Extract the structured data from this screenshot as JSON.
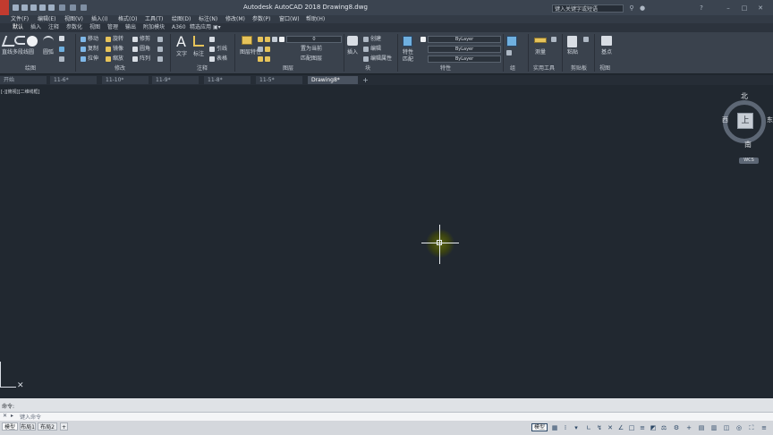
{
  "window": {
    "title": "Autodesk AutoCAD 2018    Drawing8.dwg",
    "search_placeholder": "键入关键字或短语"
  },
  "menu_items": [
    "文件(F)",
    "编辑(E)",
    "视图(V)",
    "插入(I)",
    "格式(O)",
    "工具(T)",
    "绘图(D)",
    "标注(N)",
    "修改(M)",
    "参数(P)",
    "窗口(W)",
    "帮助(H)"
  ],
  "ribbon_tabs": [
    "默认",
    "插入",
    "注释",
    "参数化",
    "视图",
    "管理",
    "输出",
    "附加模块",
    "A360",
    "精选应用"
  ],
  "ribbon": {
    "draw_tools": [
      "直线",
      "多段线",
      "圆",
      "圆弧"
    ],
    "modify_tools": [
      "移动",
      "旋转",
      "修剪",
      "复制",
      "镜像",
      "圆角",
      "拉伸",
      "缩放",
      "阵列"
    ],
    "annotation_tools": [
      "文字",
      "标注",
      "引线",
      "表格"
    ],
    "layer_tools": [
      "图层特性",
      "置为当前",
      "匹配图层"
    ],
    "block_tools": [
      "插入",
      "创建",
      "编辑",
      "编辑属性"
    ],
    "property_tools": [
      "特性",
      "匹配"
    ],
    "utility_tools": [
      "测量"
    ],
    "clipboard_tools": [
      "粘贴"
    ],
    "view_tools": [
      "基点"
    ],
    "layer_value": "0",
    "color_value": "ByLayer",
    "linetype_value": "ByLayer",
    "lineweight_value": "ByLayer",
    "panels": [
      "绘图",
      "修改",
      "注释",
      "图层",
      "块",
      "特性",
      "组",
      "实用工具",
      "剪贴板",
      "视图"
    ]
  },
  "doc_tabs": [
    "开始",
    "11-6*",
    "11-10*",
    "11-9*",
    "11-8*",
    "11-5*",
    "Drawing8*"
  ],
  "viewport_label": "[-][俯视][二维线框]",
  "viewcube": {
    "top": "上",
    "north": "北",
    "south": "南",
    "west": "西",
    "east": "东",
    "wcs": "WCS"
  },
  "command": {
    "history": "命令:",
    "prompt": "键入命令"
  },
  "layout_tabs": [
    "模型",
    "布局1",
    "布局2",
    "+"
  ],
  "statusbar": {
    "model_label": "模型"
  },
  "colors": {
    "canvas": "#212830",
    "ribbon": "#3a424d",
    "title_bar": "#3b4450",
    "app_button": "#c23b2f"
  }
}
